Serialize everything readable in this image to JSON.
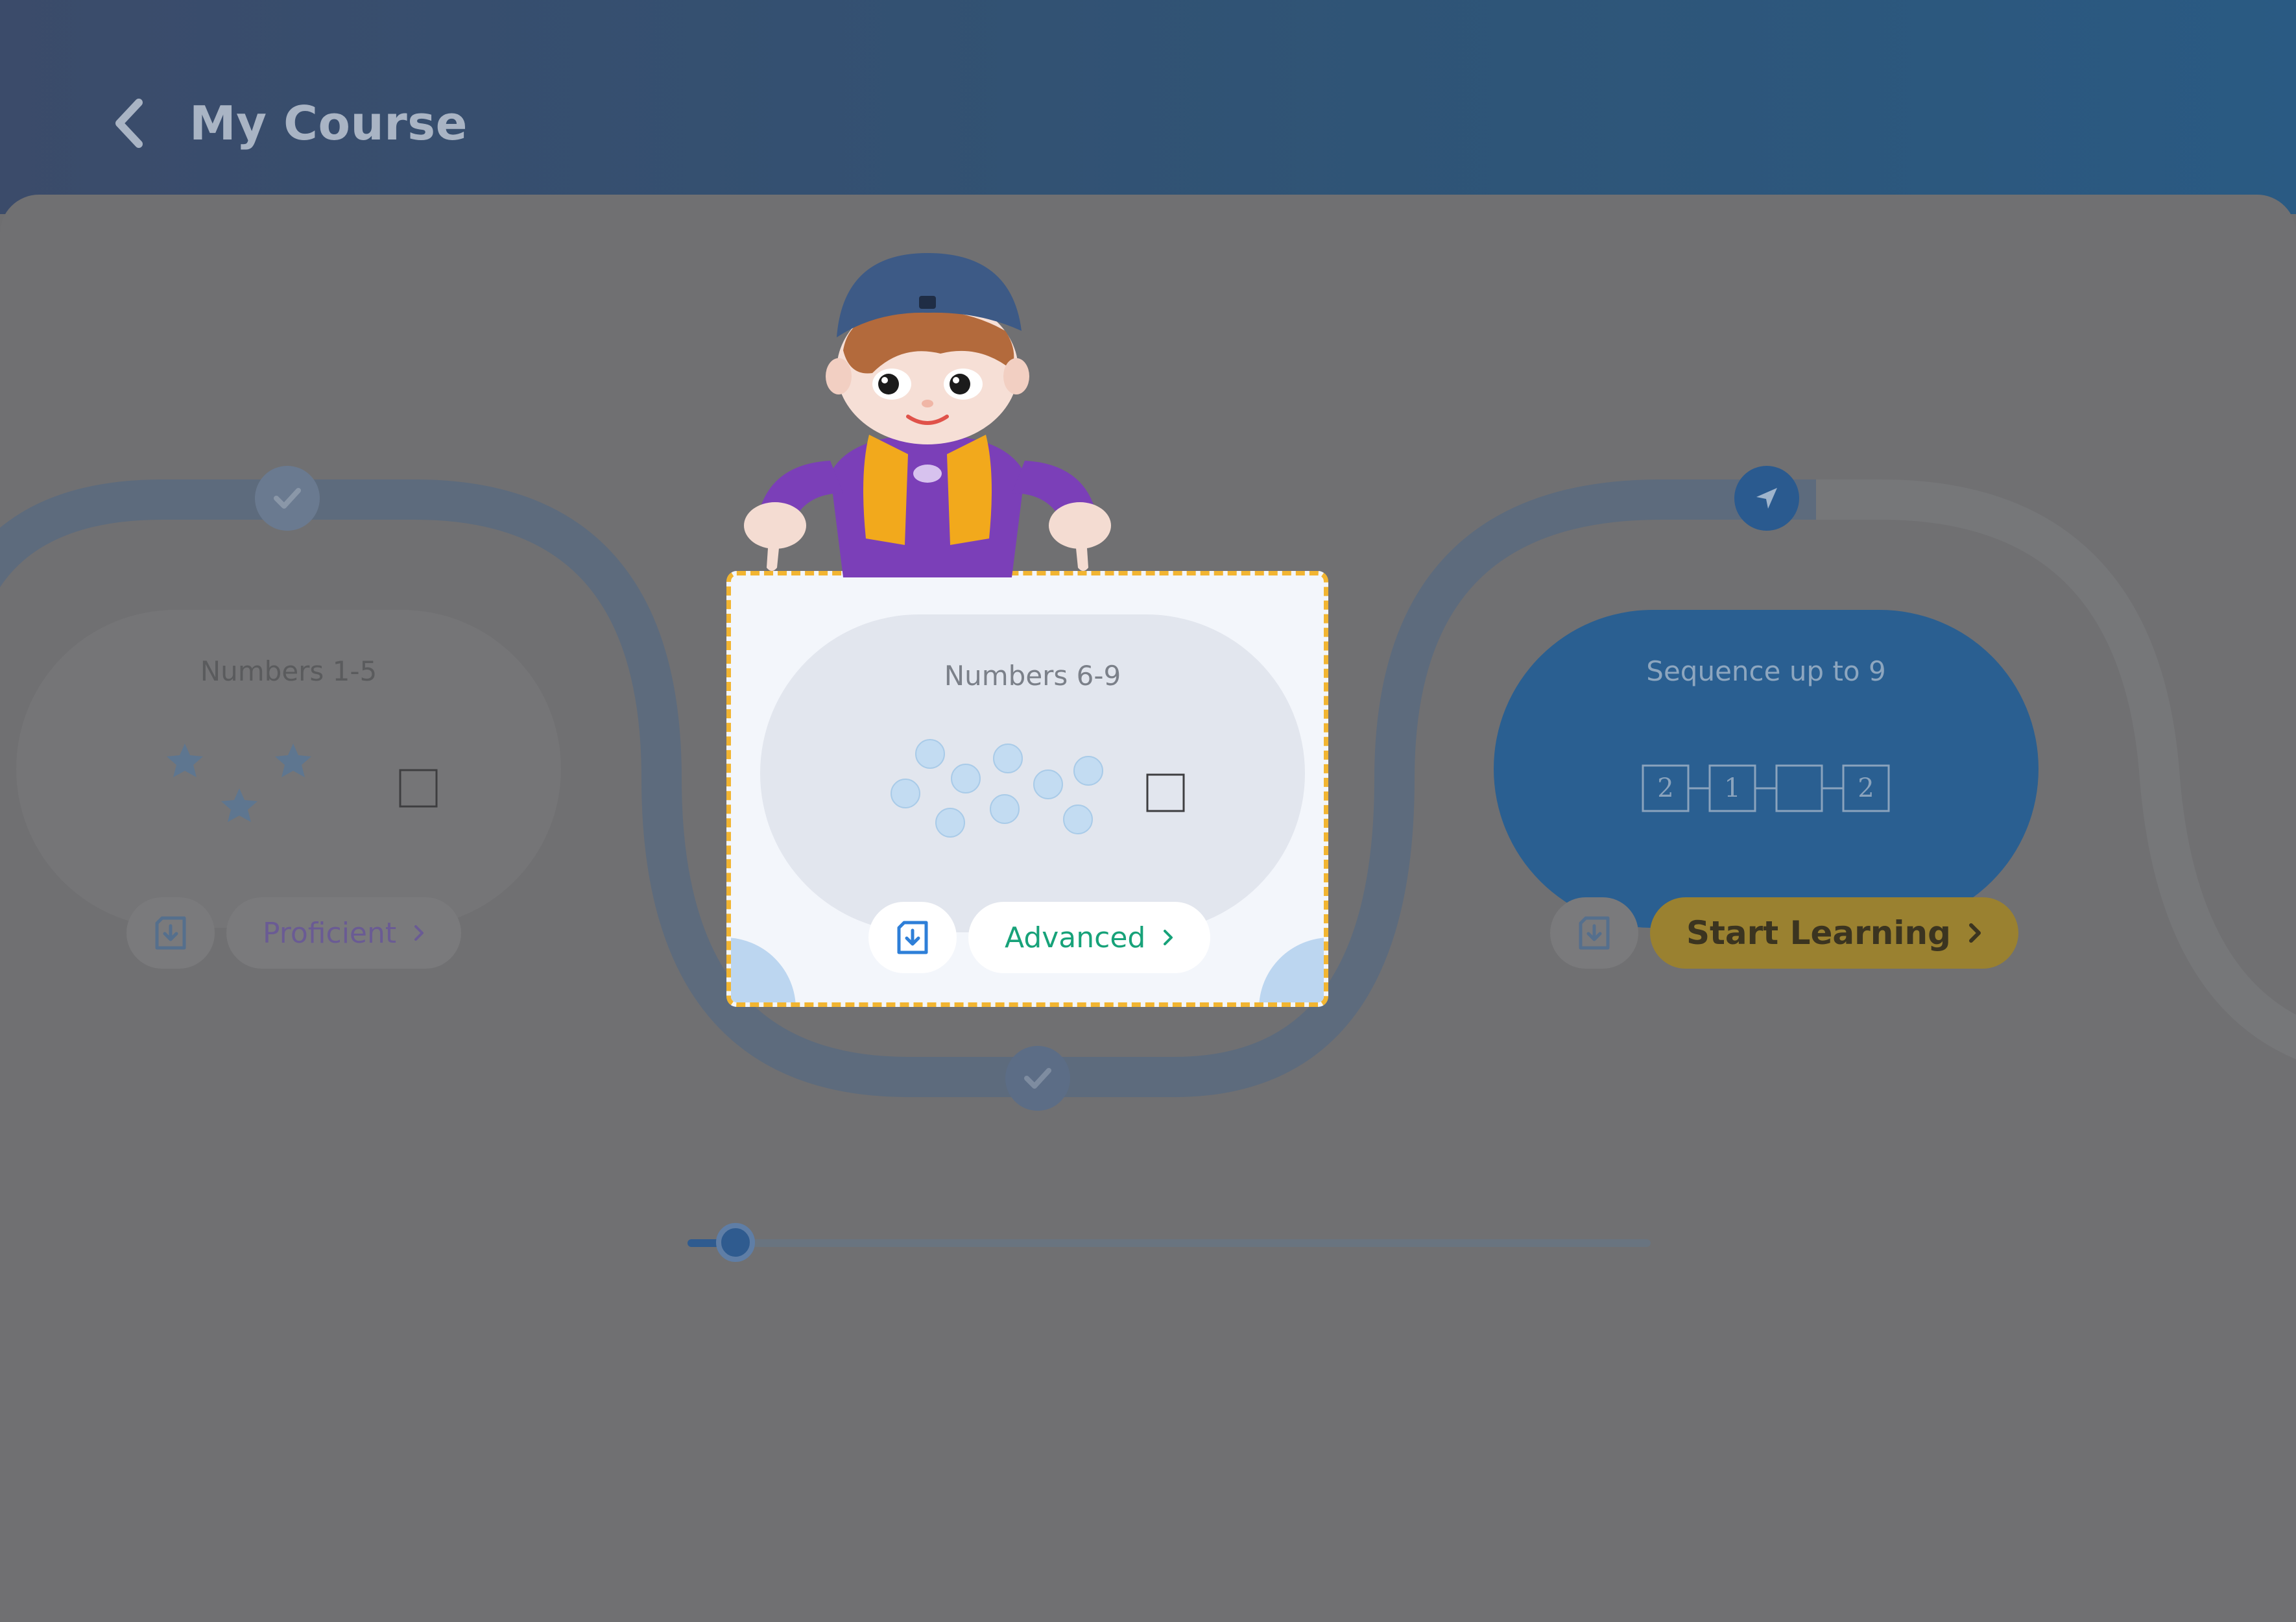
{
  "header": {
    "title": "My Course"
  },
  "lessons": [
    {
      "title": "Numbers 1-5",
      "level": "Proficient",
      "status": "completed"
    },
    {
      "title": "Numbers 6-9",
      "level": "Advanced",
      "status": "completed"
    },
    {
      "title": "Sequence up to 9",
      "level": "Start Learning",
      "status": "current",
      "sequence": [
        "2",
        "1",
        "",
        "2"
      ]
    }
  ],
  "progress": {
    "value": 0.05
  },
  "colors": {
    "path": "#5d6b7d",
    "advanced": "#17a279",
    "proficient": "#6a5b94",
    "start_button": "#9a8130",
    "highlight_border": "#f2b531"
  },
  "icons": {
    "back": "chevron-left-icon",
    "download": "download-icon",
    "completed_node": "check-icon",
    "current_node": "location-arrow-icon",
    "level_chevron": "chevron-right-icon"
  }
}
